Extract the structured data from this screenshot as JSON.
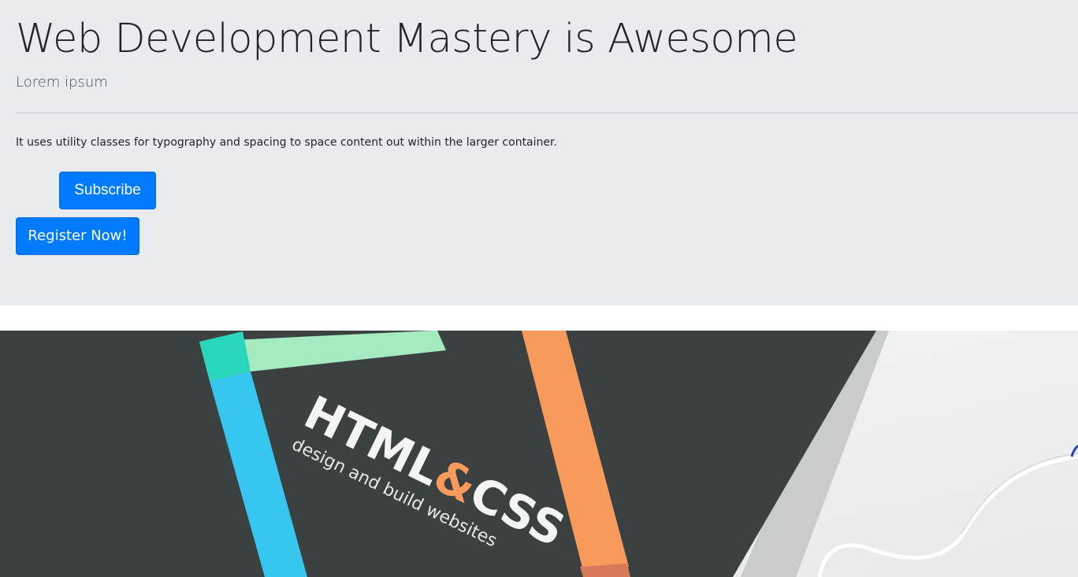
{
  "jumbotron": {
    "title": "Web Development Mastery is Awesome",
    "lead": "Lorem ipsum",
    "body_text": "It uses utility classes for typography and spacing to space content out within the larger container.",
    "subscribe_label": "Subscribe",
    "register_label": "Register Now!"
  },
  "hero_image": {
    "book_title_left": "HTML",
    "book_title_amp": "&",
    "book_title_right": "CSS",
    "book_subtitle": "design and build websites"
  },
  "colors": {
    "jumbotron_bg": "#e9ecef",
    "primary": "#007bff",
    "book_cover": "#3b4040",
    "stripe_blue": "#37c6f0",
    "stripe_orange": "#f79a5b",
    "stripe_green": "#a6ebc0",
    "stripe_teal": "#2ad6bb"
  }
}
